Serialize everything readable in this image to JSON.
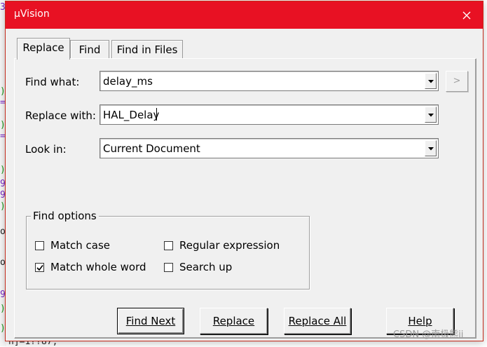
{
  "window": {
    "title": "µVision"
  },
  "tabs": [
    {
      "label": "Replace",
      "active": true
    },
    {
      "label": "Find",
      "active": false
    },
    {
      "label": "Find in Files",
      "active": false
    }
  ],
  "fields": {
    "find_what": {
      "label": "Find what:",
      "value": "delay_ms"
    },
    "replace_with": {
      "label": "Replace with:",
      "value": "HAL_Delay"
    },
    "look_in": {
      "label": "Look in:",
      "value": "Current Document"
    },
    "side_button": ">"
  },
  "find_options": {
    "legend": "Find options",
    "match_case": {
      "label": "Match case",
      "checked": false
    },
    "regular_expression": {
      "label": "Regular expression",
      "checked": false
    },
    "match_whole_word": {
      "label": "Match whole word",
      "checked": true
    },
    "search_up": {
      "label": "Search up",
      "checked": false
    }
  },
  "buttons": {
    "find_next": "Find Next",
    "replace": "Replace",
    "replace_all": "Replace All",
    "help": "Help"
  },
  "background": {
    "code_line": "n]=1??87;",
    "watermark": "CSDN @南极熊ii"
  },
  "colors": {
    "title_bar": "#e81123",
    "dialog_face": "#f0f0f0"
  }
}
